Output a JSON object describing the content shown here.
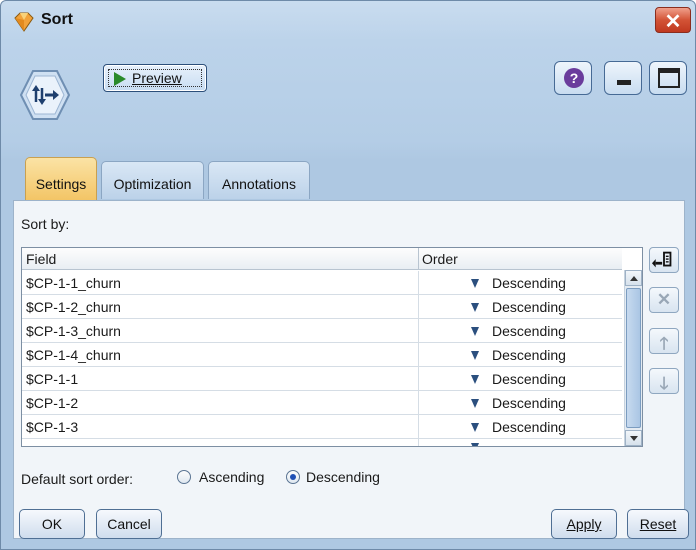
{
  "window": {
    "title": "Sort"
  },
  "toolbar": {
    "preview_label": "Preview"
  },
  "tabs": [
    {
      "label": "Settings",
      "active": true
    },
    {
      "label": "Optimization",
      "active": false
    },
    {
      "label": "Annotations",
      "active": false
    }
  ],
  "settings": {
    "sort_by_label": "Sort by:",
    "columns": {
      "field": "Field",
      "order": "Order"
    },
    "rows": [
      {
        "field": "$CP-1-1_churn",
        "order": "Descending"
      },
      {
        "field": "$CP-1-2_churn",
        "order": "Descending"
      },
      {
        "field": "$CP-1-3_churn",
        "order": "Descending"
      },
      {
        "field": "$CP-1-4_churn",
        "order": "Descending"
      },
      {
        "field": "$CP-1-1",
        "order": "Descending"
      },
      {
        "field": "$CP-1-2",
        "order": "Descending"
      },
      {
        "field": "$CP-1-3",
        "order": "Descending"
      }
    ],
    "default_sort_order_label": "Default sort order:",
    "sort_options": {
      "ascending": "Ascending",
      "descending": "Descending",
      "selected": "Descending"
    }
  },
  "buttons": {
    "ok": "OK",
    "cancel": "Cancel",
    "apply": "Apply",
    "reset": "Reset"
  },
  "icons": {
    "app": "diamond-node-icon",
    "node": "sort-node-icon",
    "help": "help-icon",
    "minimize": "minimize-icon",
    "maximize": "maximize-icon",
    "close": "close-icon",
    "pick_fields": "pick-fields-icon",
    "delete": "delete-icon",
    "move_up": "arrow-up-icon",
    "move_down": "arrow-down-icon"
  },
  "colors": {
    "active_tab": "#f3c566",
    "close": "#d35336",
    "order_arrow": "#2b4f7e"
  }
}
